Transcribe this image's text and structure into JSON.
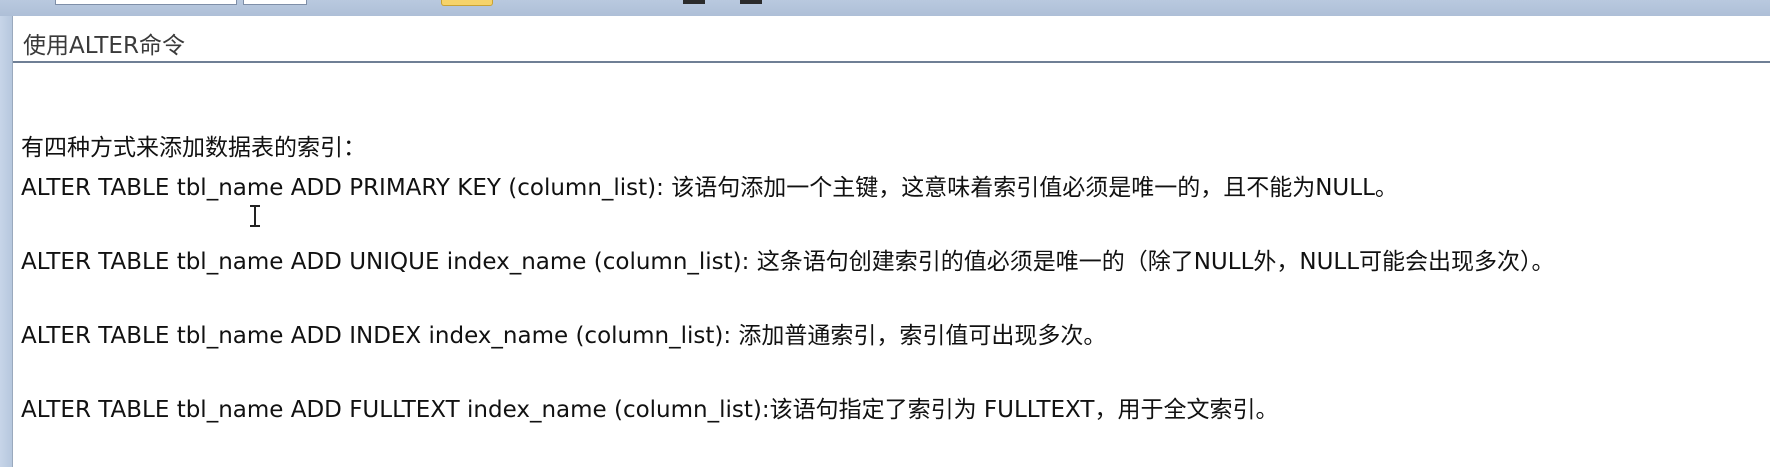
{
  "panel": {
    "title": "使用ALTER命令"
  },
  "content": {
    "intro": "有四种方式来添加数据表的索引：",
    "lines": [
      "ALTER TABLE tbl_name ADD PRIMARY KEY (column_list): 该语句添加一个主键，这意味着索引值必须是唯一的，且不能为NULL。",
      "ALTER TABLE tbl_name ADD UNIQUE index_name (column_list): 这条语句创建索引的值必须是唯一的（除了NULL外，NULL可能会出现多次）。",
      "ALTER TABLE tbl_name ADD INDEX index_name (column_list): 添加普通索引，索引值可出现多次。",
      "ALTER TABLE tbl_name ADD FULLTEXT index_name (column_list):该语句指定了索引为 FULLTEXT，用于全文索引。"
    ]
  },
  "icons": {
    "cursor": "text-cursor-icon"
  },
  "colors": {
    "frame": "#b9c9df",
    "header_rule": "#6f7f95",
    "text": "#111111",
    "title_text": "#3a3a3a"
  }
}
